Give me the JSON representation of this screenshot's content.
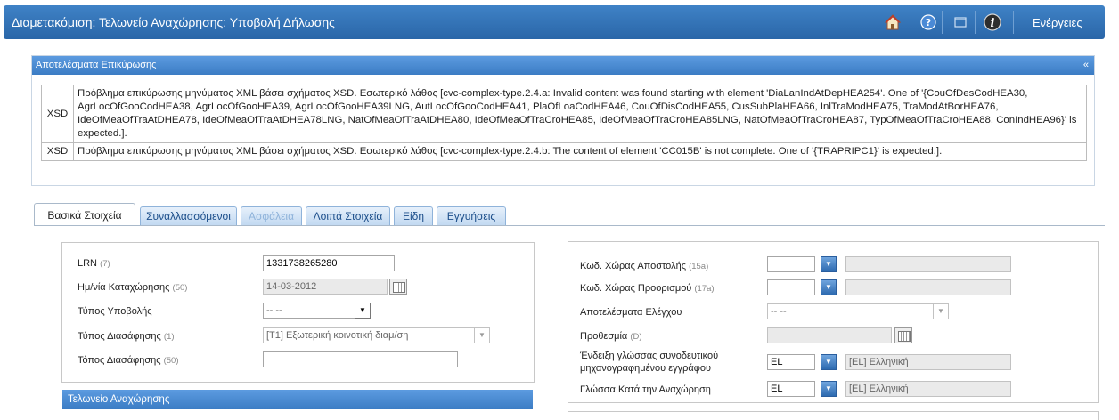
{
  "header": {
    "title": "Διαμετακόμιση: Τελωνείο Αναχώρησης: Υποβολή Δήλωσης",
    "actions_label": "Ενέργειες",
    "icons": [
      "home-icon",
      "help-icon",
      "window-icon",
      "info-icon"
    ]
  },
  "validation": {
    "title": "Αποτελέσματα Επικύρωσης",
    "collapse_glyph": "«",
    "rows": [
      {
        "code": "XSD",
        "message": "Πρόβλημα επικύρωσης μηνύματος XML βάσει σχήματος XSD. Εσωτερικό λάθος [cvc-complex-type.2.4.a: Invalid content was found starting with element 'DiaLanIndAtDepHEA254'. One of '{CouOfDesCodHEA30, AgrLocOfGooCodHEA38, AgrLocOfGooHEA39, AgrLocOfGooHEA39LNG, AutLocOfGooCodHEA41, PlaOfLoaCodHEA46, CouOfDisCodHEA55, CusSubPlaHEA66, InlTraModHEA75, TraModAtBorHEA76, IdeOfMeaOfTraAtDHEA78, IdeOfMeaOfTraAtDHEA78LNG, NatOfMeaOfTraAtDHEA80, IdeOfMeaOfTraCroHEA85, IdeOfMeaOfTraCroHEA85LNG, NatOfMeaOfTraCroHEA87, TypOfMeaOfTraCroHEA88, ConIndHEA96}' is expected.]."
      },
      {
        "code": "XSD",
        "message": "Πρόβλημα επικύρωσης μηνύματος XML βάσει σχήματος XSD. Εσωτερικό λάθος [cvc-complex-type.2.4.b: The content of element 'CC015B' is not complete. One of '{TRAPRIPC1}' is expected.]."
      }
    ]
  },
  "tabs": [
    {
      "label": "Βασικά Στοιχεία",
      "state": "active"
    },
    {
      "label": "Συναλλασσόμενοι",
      "state": "normal"
    },
    {
      "label": "Ασφάλεια",
      "state": "disabled"
    },
    {
      "label": "Λοιπά Στοιχεία",
      "state": "normal"
    },
    {
      "label": "Είδη",
      "state": "normal"
    },
    {
      "label": "Εγγυήσεις",
      "state": "normal"
    }
  ],
  "left_form": {
    "lrn": {
      "label": "LRN",
      "num": "(7)",
      "value": "1331738265280"
    },
    "declaration_date": {
      "label": "Ημ/νία Καταχώρησης",
      "num": "(50)",
      "value": "14-03-2012"
    },
    "submission_type": {
      "label": "Τύπος Υποβολής",
      "value": "-- --"
    },
    "clearance_type": {
      "label": "Τύπος Διασάφησης",
      "num": "(1)",
      "value": "[T1] Εξωτερική κοινοτική διαμ/ση"
    },
    "clearance_place": {
      "label": "Τόπος Διασάφησης",
      "num": "(50)",
      "value": ""
    },
    "departure_office_title": "Τελωνείο Αναχώρησης"
  },
  "right_form": {
    "dispatch_country": {
      "label": "Κωδ. Χώρας Αποστολής",
      "num": "(15a)",
      "value": "",
      "desc": ""
    },
    "destination_country": {
      "label": "Κωδ. Χώρας Προορισμού",
      "num": "(17a)",
      "value": "",
      "desc": ""
    },
    "control_results": {
      "label": "Αποτελέσματα Ελέγχου",
      "value": "-- --"
    },
    "deadline": {
      "label": "Προθεσμία",
      "num": "(D)",
      "value": ""
    },
    "doc_language": {
      "label_line1": "Ένδειξη γλώσσας συνοδευτικού",
      "label_line2": "μηχανογραφημένου εγγράφου",
      "value": "EL",
      "desc": "[EL] Ελληνική"
    },
    "departure_language": {
      "label": "Γλώσσα Κατά την Αναχώρηση",
      "value": "EL",
      "desc": "[EL] Ελληνική"
    }
  }
}
